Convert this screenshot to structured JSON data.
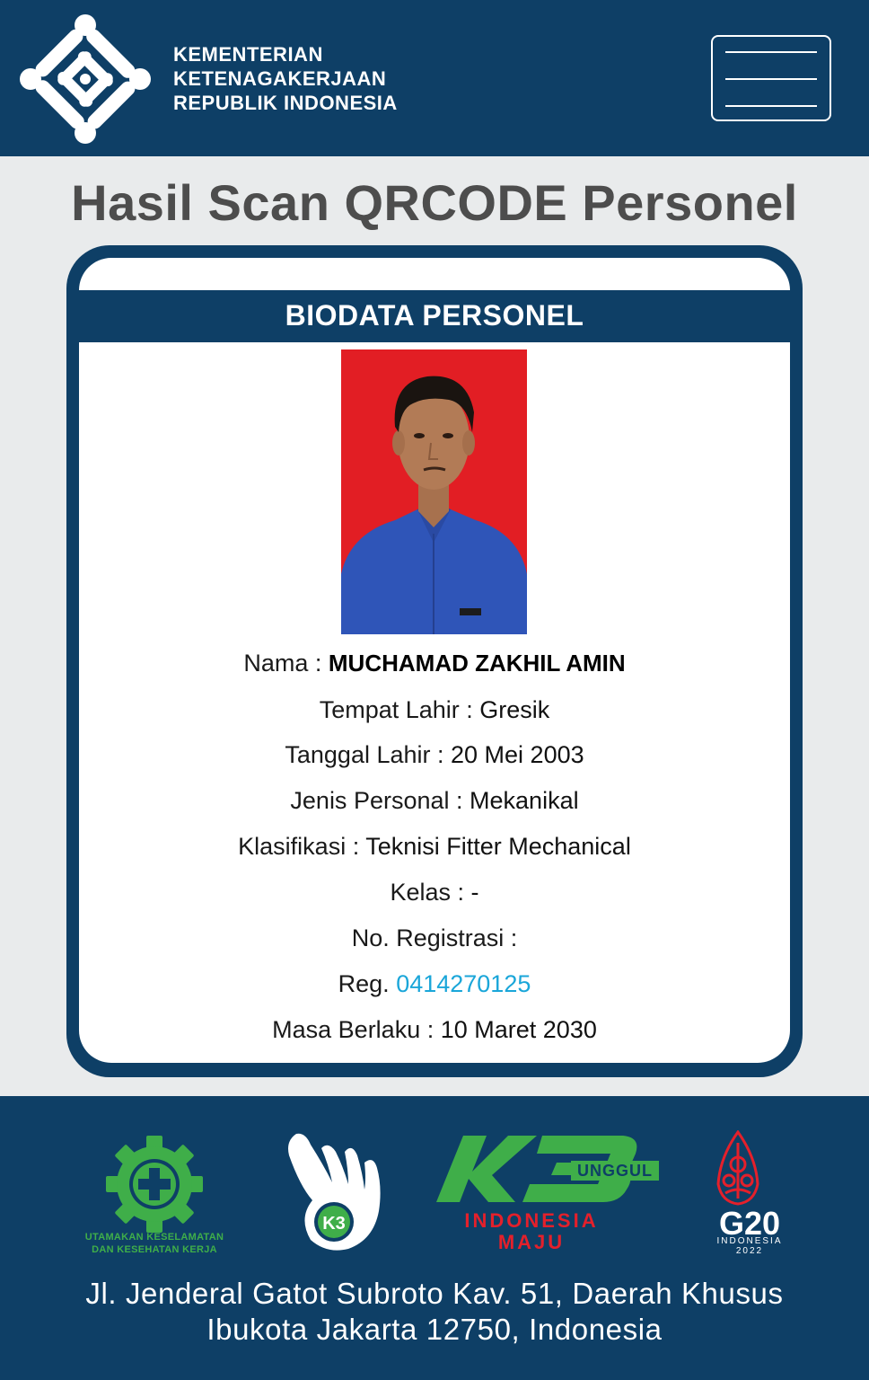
{
  "header": {
    "ministry_line1": "KEMENTERIAN",
    "ministry_line2": "KETENAGAKERJAAN",
    "ministry_line3": "REPUBLIK INDONESIA",
    "menu_icon": "hamburger-menu-icon"
  },
  "page_title": "Hasil Scan QRCODE Personel",
  "card": {
    "heading": "BIODATA PERSONEL",
    "fields": {
      "nama_label": "Nama :",
      "nama_value": "MUCHAMAD ZAKHIL AMIN",
      "tempat_lahir_label": "Tempat Lahir :",
      "tempat_lahir_value": "Gresik",
      "tanggal_lahir_label": "Tanggal Lahir :",
      "tanggal_lahir_value": "20 Mei 2003",
      "jenis_personal_label": "Jenis Personal :",
      "jenis_personal_value": "Mekanikal",
      "klasifikasi_label": "Klasifikasi :",
      "klasifikasi_value": "Teknisi Fitter Mechanical",
      "kelas_label": "Kelas :",
      "kelas_value": "-",
      "no_registrasi_label": "No. Registrasi :",
      "reg_label": "Reg.",
      "reg_value": "0414270125",
      "masa_berlaku_label": "Masa Berlaku :",
      "masa_berlaku_value": "10 Maret 2030"
    }
  },
  "footer": {
    "k3_slogan_line1": "UTAMAKAN KESELAMATAN",
    "k3_slogan_line2": "DAN KESEHATAN KERJA",
    "k3_hand_text": "K3",
    "k3_unggul": "UNGGUL",
    "indonesia": "INDONESIA",
    "maju": "MAJU",
    "g20": "G20",
    "g20_sub1": "INDONESIA",
    "g20_sub2": "2022",
    "address_line1": "Jl. Jenderal Gatot Subroto Kav. 51, Daerah Khusus",
    "address_line2": "Ibukota Jakarta 12750, Indonesia"
  },
  "colors": {
    "navy": "#0e3f66",
    "title_gray": "#4d4d4d",
    "photo_red": "#e21e24",
    "link_blue": "#1aa6d9",
    "k3_green": "#3fae49",
    "indonesia_red": "#e4202b"
  }
}
